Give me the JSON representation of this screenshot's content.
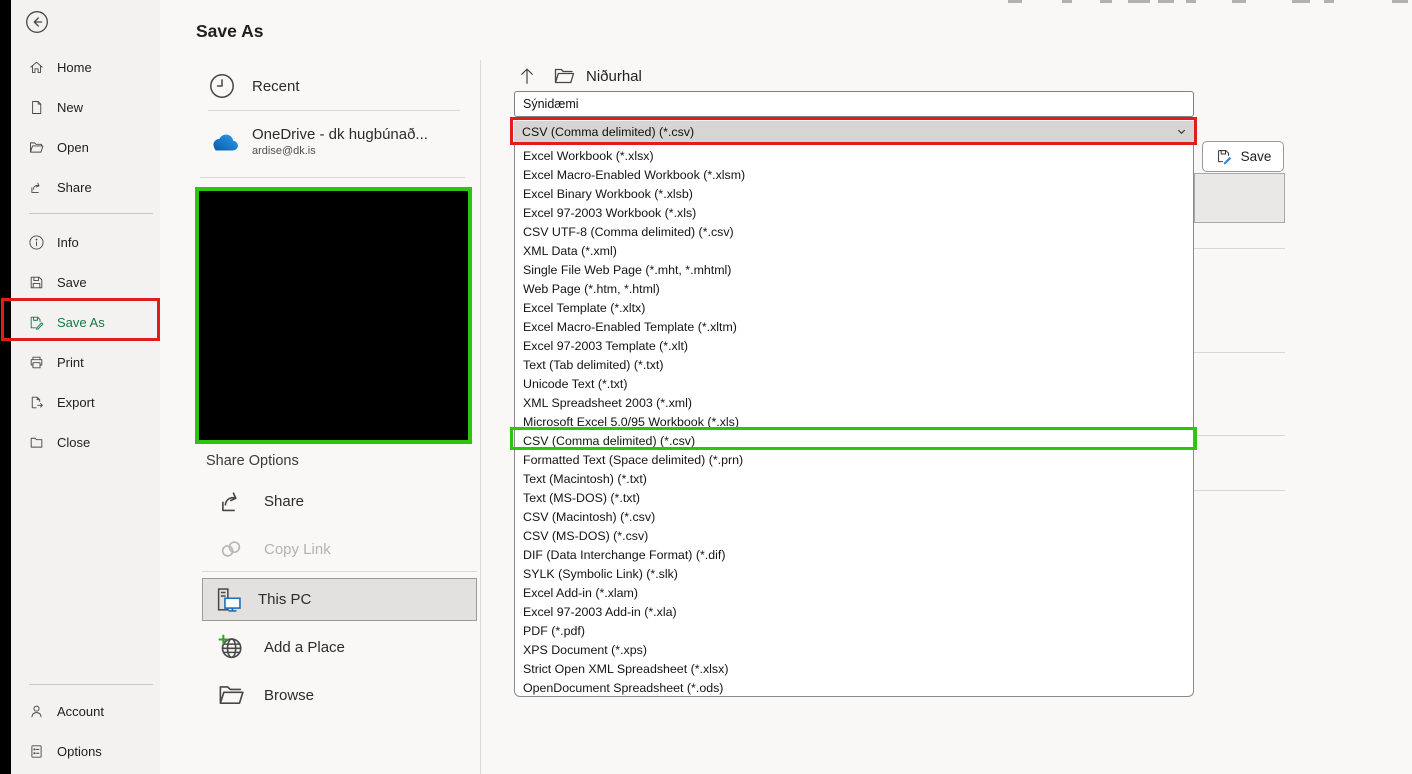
{
  "colors": {
    "accent_green": "#107C41",
    "annotation_red": "#E11C1C",
    "annotation_green": "#2BC40E",
    "onedrive_blue": "#1072C6"
  },
  "page": {
    "title": "Save As"
  },
  "sidebar": {
    "items": [
      {
        "label": "Home"
      },
      {
        "label": "New"
      },
      {
        "label": "Open"
      },
      {
        "label": "Share"
      },
      {
        "label": "Info"
      },
      {
        "label": "Save"
      },
      {
        "label": "Save As"
      },
      {
        "label": "Print"
      },
      {
        "label": "Export"
      },
      {
        "label": "Close"
      }
    ],
    "footer_items": [
      {
        "label": "Account"
      },
      {
        "label": "Options"
      }
    ]
  },
  "places": {
    "recent_label": "Recent",
    "onedrive": {
      "label": "OneDrive - dk hugbúnað...",
      "email": "ardise@dk.is"
    },
    "share_options_label": "Share Options",
    "share_label": "Share",
    "copy_link_label": "Copy Link",
    "this_pc_label": "This PC",
    "add_a_place_label": "Add a Place",
    "browse_label": "Browse"
  },
  "save_panel": {
    "folder_name": "Niðurhal",
    "filename_value": "Sýnidæmi",
    "filetype_selected": "CSV (Comma delimited) (*.csv)",
    "save_button_label": "Save"
  },
  "format_list": {
    "highlighted": "CSV (Comma delimited) (*.csv)",
    "items": [
      "Excel Workbook (*.xlsx)",
      "Excel Macro-Enabled Workbook (*.xlsm)",
      "Excel Binary Workbook (*.xlsb)",
      "Excel 97-2003 Workbook (*.xls)",
      "CSV UTF-8 (Comma delimited) (*.csv)",
      "XML Data (*.xml)",
      "Single File Web Page (*.mht, *.mhtml)",
      "Web Page (*.htm, *.html)",
      "Excel Template (*.xltx)",
      "Excel Macro-Enabled Template (*.xltm)",
      "Excel 97-2003 Template (*.xlt)",
      "Text (Tab delimited) (*.txt)",
      "Unicode Text (*.txt)",
      "XML Spreadsheet 2003 (*.xml)",
      "Microsoft Excel 5.0/95 Workbook (*.xls)",
      "CSV (Comma delimited) (*.csv)",
      "Formatted Text (Space delimited) (*.prn)",
      "Text (Macintosh) (*.txt)",
      "Text (MS-DOS) (*.txt)",
      "CSV (Macintosh) (*.csv)",
      "CSV (MS-DOS) (*.csv)",
      "DIF (Data Interchange Format) (*.dif)",
      "SYLK (Symbolic Link) (*.slk)",
      "Excel Add-in (*.xlam)",
      "Excel 97-2003 Add-in (*.xla)",
      "PDF (*.pdf)",
      "XPS Document (*.xps)",
      "Strict Open XML Spreadsheet (*.xlsx)",
      "OpenDocument Spreadsheet (*.ods)"
    ]
  }
}
